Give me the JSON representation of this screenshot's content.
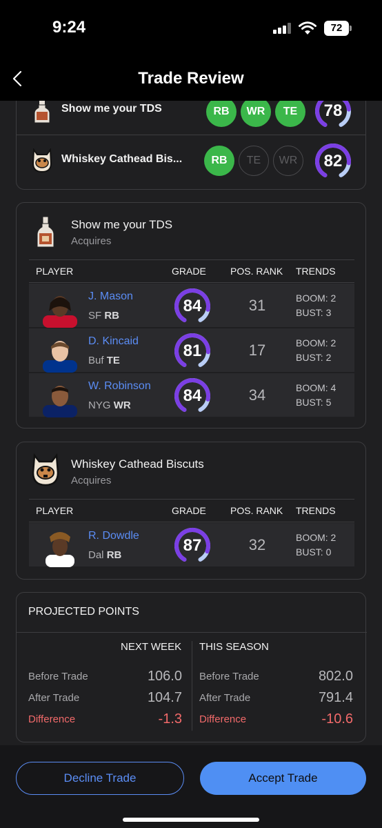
{
  "status": {
    "time": "9:24",
    "battery": "72"
  },
  "nav": {
    "title": "Trade Review"
  },
  "summary": {
    "teams": [
      {
        "name": "Show me your TDS",
        "positions": [
          {
            "label": "RB",
            "filled": true
          },
          {
            "label": "WR",
            "filled": true
          },
          {
            "label": "TE",
            "filled": true
          }
        ],
        "grade": "78",
        "grade_value": 78
      },
      {
        "name": "Whiskey Cathead Bis...",
        "positions": [
          {
            "label": "RB",
            "filled": true
          },
          {
            "label": "TE",
            "filled": false
          },
          {
            "label": "WR",
            "filled": false
          }
        ],
        "grade": "82",
        "grade_value": 82
      }
    ]
  },
  "columns": {
    "player": "PLAYER",
    "grade": "GRADE",
    "pos_rank": "POS. RANK",
    "trends": "TRENDS"
  },
  "acquires": [
    {
      "team": "Show me your TDS",
      "subtitle": "Acquires",
      "players": [
        {
          "name": "J. Mason",
          "team": "SF",
          "pos": "RB",
          "grade": "84",
          "grade_value": 84,
          "rank": "31",
          "boom": "BOOM: 2",
          "bust": "BUST: 3"
        },
        {
          "name": "D. Kincaid",
          "team": "Buf",
          "pos": "TE",
          "grade": "81",
          "grade_value": 81,
          "rank": "17",
          "boom": "BOOM: 2",
          "bust": "BUST: 2"
        },
        {
          "name": "W. Robinson",
          "team": "NYG",
          "pos": "WR",
          "grade": "84",
          "grade_value": 84,
          "rank": "34",
          "boom": "BOOM: 4",
          "bust": "BUST: 5"
        }
      ]
    },
    {
      "team": "Whiskey Cathead Biscuts",
      "subtitle": "Acquires",
      "players": [
        {
          "name": "R. Dowdle",
          "team": "Dal",
          "pos": "RB",
          "grade": "87",
          "grade_value": 87,
          "rank": "32",
          "boom": "BOOM: 2",
          "bust": "BUST: 0"
        }
      ]
    }
  ],
  "projected": {
    "title": "PROJECTED POINTS",
    "next_week": {
      "header": "NEXT WEEK",
      "before_label": "Before Trade",
      "before": "106.0",
      "after_label": "After Trade",
      "after": "104.7",
      "diff_label": "Difference",
      "diff": "-1.3"
    },
    "this_season": {
      "header": "THIS SEASON",
      "before_label": "Before Trade",
      "before": "802.0",
      "after_label": "After Trade",
      "after": "791.4",
      "diff_label": "Difference",
      "diff": "-10.6"
    }
  },
  "actions": {
    "decline": "Decline Trade",
    "accept": "Accept Trade"
  },
  "colors": {
    "accent": "#5b8df5",
    "position_chip": "#3bb74a",
    "gauge": "#7b3fe4",
    "negative": "#f26a6a"
  }
}
